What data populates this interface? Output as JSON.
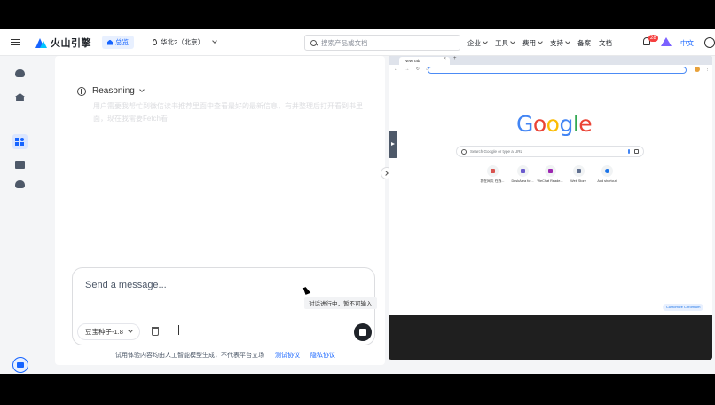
{
  "nav": {
    "brand": "火山引擎",
    "overview": "总览",
    "region": "华北2（北京）",
    "search_placeholder": "搜索产品或文档",
    "links": [
      "企业",
      "工具",
      "费用",
      "支持",
      "备案",
      "文档"
    ],
    "link_has_dropdown": [
      true,
      true,
      true,
      true,
      false,
      false
    ],
    "notification_count": "28",
    "language": "中文"
  },
  "chat": {
    "reasoning_label": "Reasoning",
    "reasoning_text": "用户需要我帮忙到微信读书推荐里面中查看最好的最新信息，有并整理后打开看到书里面，现在我需要Fetch看",
    "input_placeholder": "Send a message...",
    "model": "豆宝种子-1.8",
    "tooltip": "对话进行中，暂不可输入",
    "footer_text": "试用体验内容均由人工智能模型生成，不代表平台立场",
    "terms_link": "测试协议",
    "privacy_link": "隐私协议"
  },
  "browser": {
    "tab_title": "New Tab",
    "nav_buttons": "← → ↻ ⌂",
    "google_letters": [
      "G",
      "o",
      "o",
      "g",
      "l",
      "e"
    ],
    "google_colors": [
      "#4285f4",
      "#ea4335",
      "#fbbc05",
      "#4285f4",
      "#34a853",
      "#ea4335"
    ],
    "search_placeholder": "Search Google or type a URL",
    "shortcuts": [
      {
        "label": "我在网页 在线...",
        "color": "#d9534f"
      },
      {
        "label": "DeskArea for...",
        "color": "#6a5acd"
      },
      {
        "label": "WeChat Reade...",
        "color": "#9c27b0"
      },
      {
        "label": "Web Store",
        "color": "#5f6f8f"
      },
      {
        "label": "Add shortcut",
        "color": "#1a73e8"
      }
    ],
    "customize": "Customize Chromium"
  }
}
